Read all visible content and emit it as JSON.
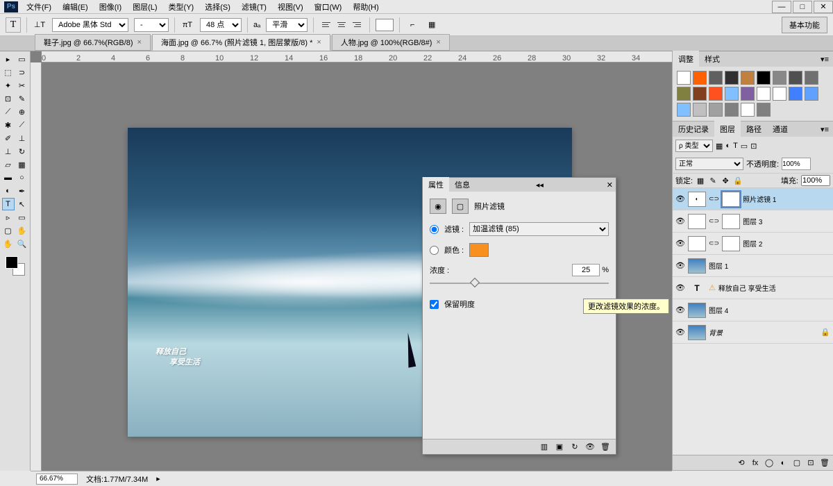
{
  "menu": {
    "file": "文件(F)",
    "edit": "编辑(E)",
    "image": "图像(I)",
    "layer": "图层(L)",
    "type": "类型(Y)",
    "select": "选择(S)",
    "filter": "滤镜(T)",
    "view": "视图(V)",
    "window": "窗口(W)",
    "help": "帮助(H)"
  },
  "options": {
    "font": "Adobe 黑体 Std",
    "size": "48 点",
    "aa": "平滑",
    "workspace": "基本功能"
  },
  "tabs": [
    {
      "label": "鞋子.jpg @ 66.7%(RGB/8)",
      "active": false
    },
    {
      "label": "海面.jpg @ 66.7% (照片滤镜 1, 图层蒙版/8) *",
      "active": true
    },
    {
      "label": "人物.jpg @ 100%(RGB/8#)",
      "active": false
    }
  ],
  "ruler_ticks": [
    "0",
    "2",
    "4",
    "6",
    "8",
    "10",
    "12",
    "14",
    "16",
    "18",
    "20",
    "22",
    "24",
    "26",
    "28",
    "30",
    "32",
    "34"
  ],
  "canvas_text": {
    "line1": "释放自己",
    "line2": "享受生活"
  },
  "panels": {
    "adjust_tab": "调整",
    "styles_tab": "样式",
    "history_tab": "历史记录",
    "layers_tab": "图层",
    "paths_tab": "路径",
    "channels_tab": "通道"
  },
  "layer_panel": {
    "kind": "ρ 类型",
    "blend": "正常",
    "opacity_label": "不透明度:",
    "opacity": "100%",
    "lock_label": "锁定:",
    "fill_label": "填充:",
    "fill": "100%"
  },
  "layers": [
    {
      "name": "照片滤镜 1",
      "sel": true,
      "adj": true
    },
    {
      "name": "图层 3",
      "mask": true
    },
    {
      "name": "图层 2",
      "mask": true
    },
    {
      "name": "图层 1"
    },
    {
      "name": "释放自己   享受生活",
      "text": true,
      "warn": true
    },
    {
      "name": "图层 4"
    },
    {
      "name": "背景",
      "lock": true,
      "italic": true
    }
  ],
  "props": {
    "tab_prop": "属性",
    "tab_info": "信息",
    "title": "照片滤镜",
    "filter_label": "滤镜 :",
    "filter_value": "加温滤镜 (85)",
    "color_label": "颜色 :",
    "density_label": "浓度 :",
    "density_value": "25",
    "density_unit": "%",
    "preserve": "保留明度",
    "tooltip": "更改滤镜效果的浓度。"
  },
  "swatch_colors": [
    "#ffffff",
    "#ff6000",
    "#606060",
    "#303030",
    "#c08040",
    "#000000",
    "#888888",
    "#505050",
    "#707070",
    "#808040",
    "#804020",
    "#ff5020",
    "#80c0ff",
    "#8060a0",
    "#ffffff",
    "#ffffff",
    "#4080ff",
    "#60a0ff",
    "#80c0ff",
    "#c0c0c0",
    "#a0a0a0",
    "#808080",
    "#ffffff",
    "#808080"
  ],
  "status": {
    "zoom": "66.67%",
    "doc_label": "文档:",
    "doc_size": "1.77M/7.34M"
  }
}
